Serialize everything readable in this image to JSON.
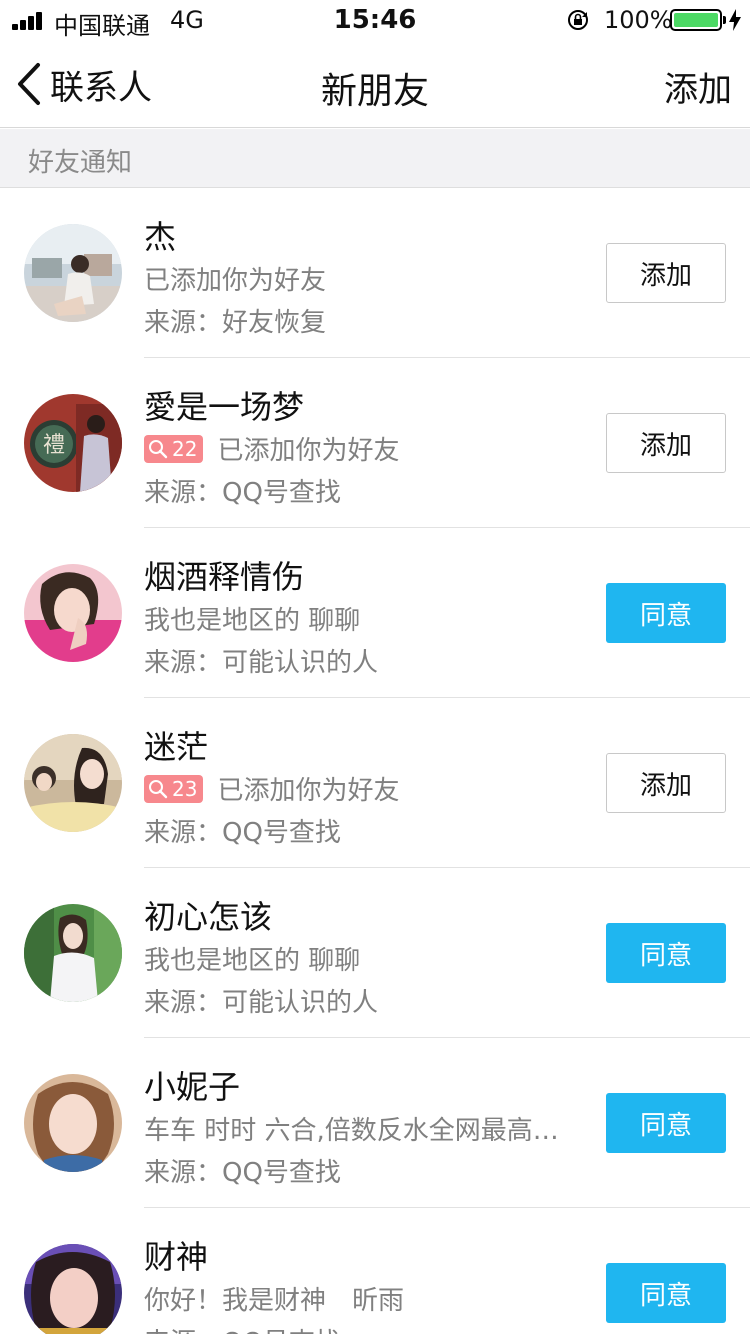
{
  "status_bar": {
    "carrier": "中国联通",
    "network": "4G",
    "time": "15:46",
    "battery": "100%"
  },
  "nav": {
    "back_label": "联系人",
    "title": "新朋友",
    "action": "添加"
  },
  "section": {
    "title": "好友通知"
  },
  "rows": [
    {
      "name": "杰",
      "badge": "",
      "message": "已添加你为好友",
      "source": "来源：好友恢复",
      "button": "添加",
      "button_style": "outline"
    },
    {
      "name": "愛是一场梦",
      "badge": "22",
      "message": "已添加你为好友",
      "source": "来源：QQ号查找",
      "button": "添加",
      "button_style": "outline"
    },
    {
      "name": "烟酒释情伤",
      "badge": "",
      "message": "我也是地区的 聊聊",
      "source": "来源：可能认识的人",
      "button": "同意",
      "button_style": "primary"
    },
    {
      "name": "迷茫",
      "badge": "23",
      "message": "已添加你为好友",
      "source": "来源：QQ号查找",
      "button": "添加",
      "button_style": "outline"
    },
    {
      "name": "初心怎该",
      "badge": "",
      "message": "我也是地区的 聊聊",
      "source": "来源：可能认识的人",
      "button": "同意",
      "button_style": "primary"
    },
    {
      "name": "小妮子",
      "badge": "",
      "message": "车车 时时 六合,倍数反水全网最高…",
      "source": "来源：QQ号查找",
      "button": "同意",
      "button_style": "primary"
    },
    {
      "name": "财神",
      "badge": "",
      "message": "你好！我是财神　昕雨",
      "source": "来源：QQ号查找",
      "button": "同意",
      "button_style": "primary"
    }
  ],
  "colors": {
    "accent": "#1fb6f0",
    "badge": "#f7888d",
    "battery": "#4cd964"
  }
}
